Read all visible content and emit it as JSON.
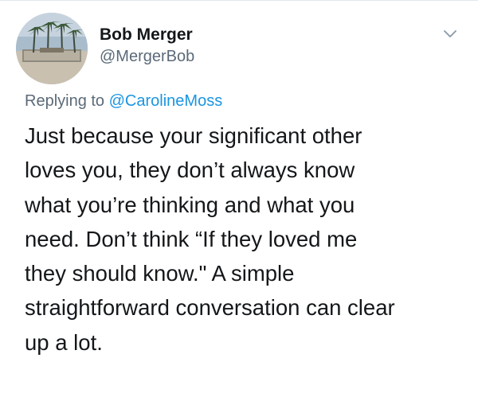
{
  "author": {
    "display_name": "Bob Merger",
    "handle": "@MergerBob",
    "avatar_icon": "profile-photo-palm-trees"
  },
  "menu": {
    "icon": "chevron-down-icon"
  },
  "reply": {
    "prefix": "Replying to ",
    "mention": "@CarolineMoss"
  },
  "tweet": {
    "lines": [
      "Just because your significant other",
      "loves you, they don’t always know",
      "what you’re thinking and what you",
      "need. Don’t think “If they loved me",
      "they should know.\" A simple",
      "straightforward conversation can clear",
      "up a lot."
    ]
  },
  "colors": {
    "text": "#14171a",
    "secondary": "#5b6a78",
    "link": "#1b95e0",
    "divider": "#e1e8ed"
  }
}
